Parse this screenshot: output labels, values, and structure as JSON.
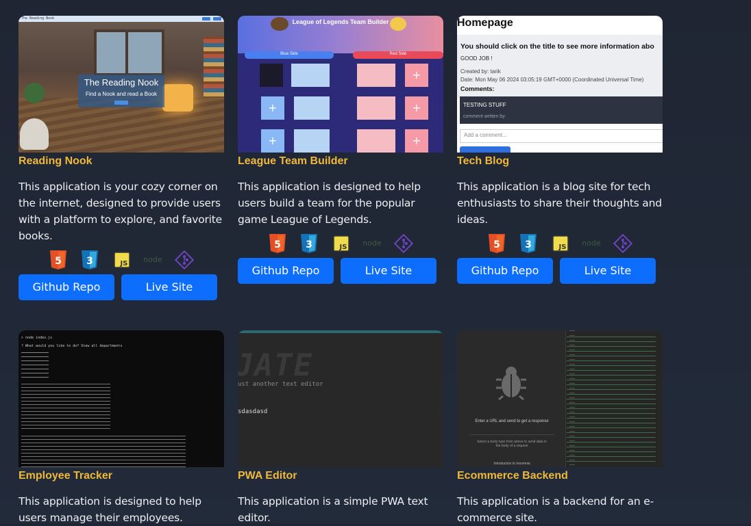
{
  "colors": {
    "accent_title": "#f0b93a",
    "button_bg": "#0d6efd",
    "page_bg": "#1f2533"
  },
  "cards": [
    {
      "title": "Reading Nook",
      "description": "This application is your cozy corner on the internet, designed to provide users with a platform to explore, and favorite books.",
      "screenshot": {
        "nav_title": "The Reading Nook",
        "heading": "The Reading Nook",
        "subheading": "Find a Nook and read a Book"
      },
      "icons": [
        "html5-icon",
        "css3-icon",
        "javascript-icon",
        "nodejs-icon",
        "git-icon"
      ],
      "buttons": [
        "Github Repo",
        "Live Site"
      ]
    },
    {
      "title": "League Team Builder",
      "description": "This application is designed to help users build a team for the popular game League of Legends.",
      "screenshot": {
        "heading": "League of Legends Team Builder",
        "blue_side": "Blue Side",
        "red_side": "Red Side",
        "plus": "+"
      },
      "icons": [
        "html5-icon",
        "css3-icon",
        "javascript-icon",
        "nodejs-icon",
        "git-icon"
      ],
      "buttons": [
        "Github Repo",
        "Live Site"
      ]
    },
    {
      "title": "Tech Blog",
      "description": "This application is a blog site for tech enthusiasts to share their thoughts and ideas.",
      "screenshot": {
        "heading": "Homepage",
        "prompt": "You should click on the title to see more information abo",
        "post": "GOOD JOB !",
        "created_by": "Created by: tarik",
        "date": "Date: Mon May 06 2024 03:05:19 GMT+0000 (Coordinated Universal Time)",
        "comments_label": "Comments:",
        "comment": "TESTING STUFF",
        "comment_meta": "comment written by:",
        "add_comment": "Add a comment..."
      },
      "icons": [
        "html5-icon",
        "css3-icon",
        "javascript-icon",
        "nodejs-icon",
        "git-icon"
      ],
      "buttons": [
        "Github Repo",
        "Live Site"
      ]
    },
    {
      "title": "Employee Tracker",
      "description": "This application is designed to help users manage their employees.",
      "screenshot": {
        "cmd": "> node index.js",
        "question": "? What would you like to do? View all departments"
      }
    },
    {
      "title": "PWA Editor",
      "description": "This application is a simple PWA text editor.",
      "screenshot": {
        "logo": "JATE",
        "tagline": "ust another text editor",
        "typed": "sdasdasd"
      }
    },
    {
      "title": "Ecommerce Backend",
      "description": "This application is a backend for an e-commerce site.",
      "screenshot": {
        "hint": "Enter a URL and send to get a response",
        "hint2": "Select a body type from above to send data in the body of a request",
        "link": "Introduction to Insomnia"
      }
    }
  ]
}
